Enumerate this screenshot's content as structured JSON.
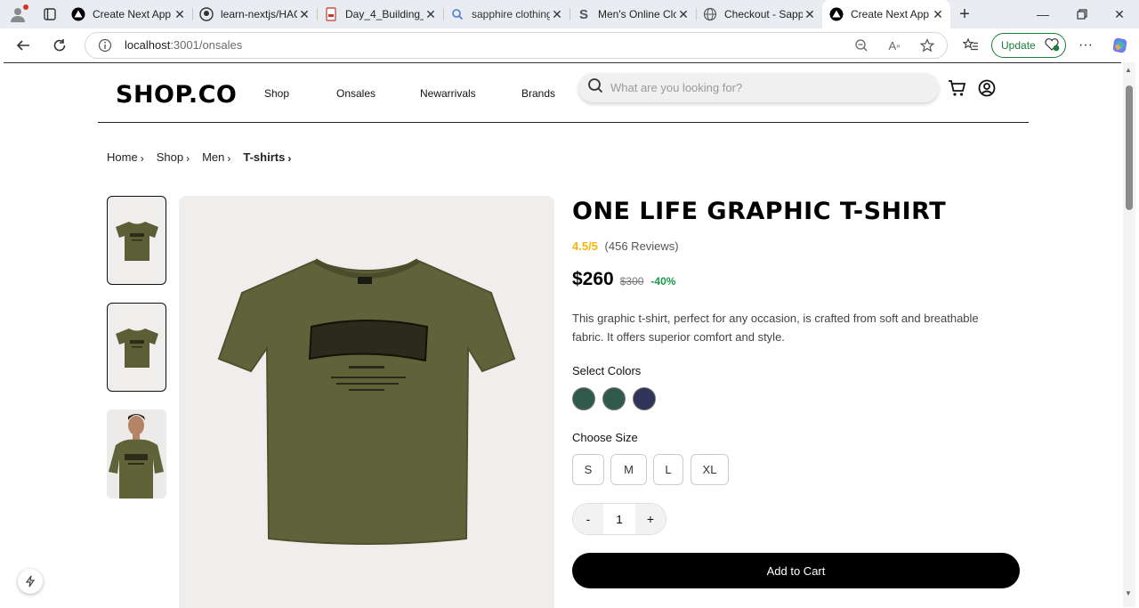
{
  "browser": {
    "tabs": [
      {
        "title": "Create Next App",
        "icon": "triangle-logo-icon"
      },
      {
        "title": "learn-nextjs/HAC",
        "icon": "github-icon"
      },
      {
        "title": "Day_4_Building_D",
        "icon": "pdf-icon"
      },
      {
        "title": "sapphire clothing",
        "icon": "search-icon"
      },
      {
        "title": "Men's Online Clo",
        "icon": "s-logo-icon"
      },
      {
        "title": "Checkout - Sapph",
        "icon": "globe-icon"
      },
      {
        "title": "Create Next App",
        "icon": "triangle-logo-icon",
        "active": true
      }
    ],
    "url_host": "localhost",
    "url_path": ":3001/onsales",
    "update_label": "Update"
  },
  "header": {
    "logo": "SHOP.CO",
    "nav": [
      "Shop",
      "Onsales",
      "Newarrivals",
      "Brands"
    ],
    "search_placeholder": "What are you looking for?"
  },
  "breadcrumb": [
    "Home",
    "Shop",
    "Men",
    "T-shirts"
  ],
  "product": {
    "title": "ONE LIFE GRAPHIC T-SHIRT",
    "rating": "4.5/5",
    "reviews": "(456 Reviews)",
    "price": "$260",
    "old_price": "$300",
    "discount": "-40%",
    "description": "This graphic t-shirt, perfect for any occasion, is crafted from soft and breathable fabric. It offers superior comfort and style.",
    "colors_label": "Select Colors",
    "colors": [
      "#2f5a4e",
      "#315a4a",
      "#2f3458"
    ],
    "size_label": "Choose Size",
    "sizes": [
      "S",
      "M",
      "L",
      "XL"
    ],
    "qty_minus": "-",
    "qty_value": "1",
    "qty_plus": "+",
    "add_to_cart": "Add to Cart"
  }
}
